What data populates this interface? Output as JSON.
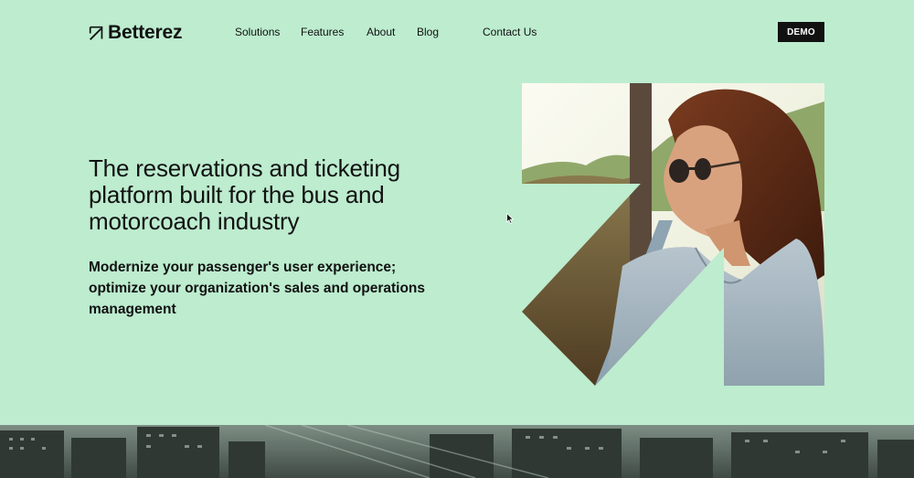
{
  "brand": {
    "name": "Betterez",
    "logo_icon": "arrow-up-right-icon"
  },
  "nav": {
    "items": [
      "Solutions",
      "Features",
      "About",
      "Blog",
      "Contact Us"
    ]
  },
  "header": {
    "demo_label": "DEMO"
  },
  "hero": {
    "title": "The reservations and ticketing platform built for the bus and motorcoach industry",
    "subtitle": "Modernize your passenger's user experience; optimize your organization's sales and operations management"
  },
  "colors": {
    "background": "#bdeccf",
    "text": "#111111",
    "button_bg": "#111111",
    "button_text": "#ffffff"
  }
}
